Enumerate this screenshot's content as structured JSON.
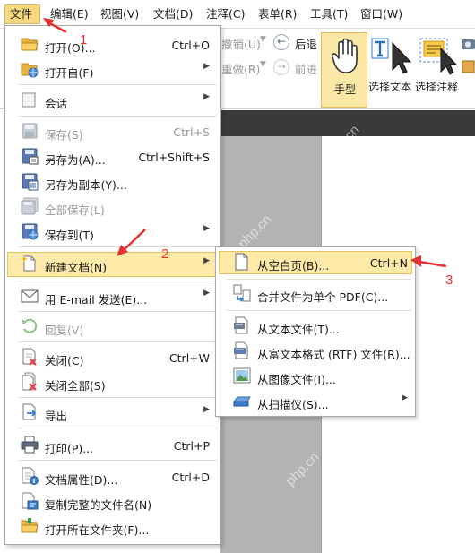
{
  "menubar": {
    "items": [
      "文件",
      "编辑(E)",
      "视图(V)",
      "文档(D)",
      "注释(C)",
      "表单(R)",
      "工具(T)",
      "窗口(W)"
    ]
  },
  "ribbon": {
    "undo": "撤销(U)",
    "redo": "重做(R)",
    "back": "后退",
    "forward": "前进",
    "hand": "手型",
    "select_text": "选择文本",
    "select_annotation": "选择注释"
  },
  "file_menu": {
    "open": {
      "label": "打开(O)...",
      "shortcut": "Ctrl+O"
    },
    "open_from": {
      "label": "打开自(F)"
    },
    "session": {
      "label": "会话"
    },
    "save": {
      "label": "保存(S)",
      "shortcut": "Ctrl+S"
    },
    "save_as": {
      "label": "另存为(A)...",
      "shortcut": "Ctrl+Shift+S"
    },
    "save_copy": {
      "label": "另存为副本(Y)..."
    },
    "save_all": {
      "label": "全部保存(L)"
    },
    "save_to": {
      "label": "保存到(T)"
    },
    "new_doc": {
      "label": "新建文档(N)"
    },
    "email": {
      "label": "用 E-mail 发送(E)..."
    },
    "revert": {
      "label": "回复(V)"
    },
    "close": {
      "label": "关闭(C)",
      "shortcut": "Ctrl+W"
    },
    "close_all": {
      "label": "关闭全部(S)"
    },
    "export": {
      "label": "导出"
    },
    "print": {
      "label": "打印(P)...",
      "shortcut": "Ctrl+P"
    },
    "properties": {
      "label": "文档属性(D)...",
      "shortcut": "Ctrl+D"
    },
    "copy_name": {
      "label": "复制完整的文件名(N)"
    },
    "open_folder": {
      "label": "打开所在文件夹(F)..."
    }
  },
  "new_menu": {
    "blank": {
      "label": "从空白页(B)...",
      "shortcut": "Ctrl+N"
    },
    "combine": {
      "label": "合并文件为单个 PDF(C)..."
    },
    "from_text": {
      "label": "从文本文件(T)..."
    },
    "from_rtf": {
      "label": "从富文本格式 (RTF) 文件(R)..."
    },
    "from_image": {
      "label": "从图像文件(I)..."
    },
    "from_scanner": {
      "label": "从扫描仪(S)..."
    }
  },
  "annotations": {
    "a1": "1",
    "a2": "2",
    "a3": "3"
  },
  "watermark": "php.cn",
  "colors": {
    "highlight": "#fde9a8",
    "annotation": "#e53030",
    "accent_border": "#e8c45a"
  }
}
